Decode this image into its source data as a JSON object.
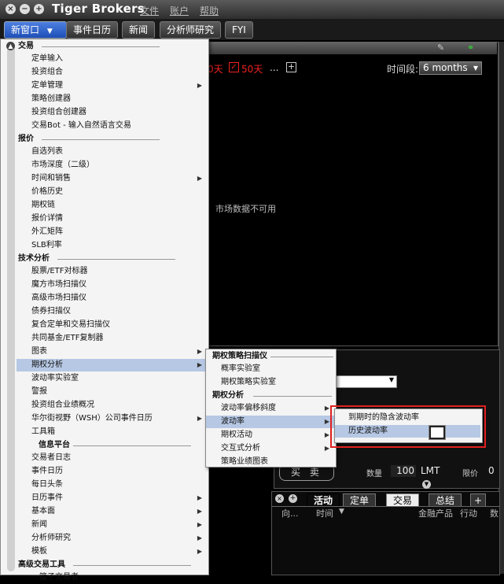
{
  "window": {
    "title": "Tiger Brokers",
    "menus": [
      "文件",
      "账户",
      "帮助"
    ]
  },
  "toolbar": {
    "new_window": "新窗口",
    "buttons": [
      "事件日历",
      "新闻",
      "分析师研究",
      "FYI"
    ]
  },
  "chart_panel": {
    "days_a": "0天",
    "days_b": "50天",
    "more": "...",
    "add": "+",
    "period_label": "时间段:",
    "period_value": "6 months",
    "no_data": "市场数据不可用"
  },
  "main_menu": {
    "sections": [
      {
        "title": "交易",
        "items": [
          "定单输入",
          "投资组合",
          "定单管理",
          "策略创建器",
          "投资组合创建器",
          "交易Bot - 输入自然语言交易"
        ]
      },
      {
        "title": "报价",
        "items": [
          "自选列表",
          "市场深度（二级）",
          "时间和销售",
          "价格历史",
          "期权链",
          "报价详情",
          "外汇矩阵",
          "SLB利率"
        ]
      },
      {
        "title": "技术分析",
        "items": [
          "股票/ETF对标器",
          "魔方市场扫描仪",
          "高级市场扫描仪",
          "债券扫描仪",
          "复合定单和交易扫描仪",
          "共同基金/ETF复制器",
          "图表",
          "期权分析",
          "波动率实验室",
          "警报",
          "投资组合业绩概况",
          "华尔街视野（WSH）公司事件日历",
          "工具箱"
        ]
      },
      {
        "title": "信息平台",
        "items": [
          "交易者日志",
          "事件日历",
          "每日头条",
          "日历事件",
          "基本面",
          "新闻",
          "分析师研究",
          "模板"
        ]
      },
      {
        "title": "高级交易工具",
        "items": [
          "一篮子交易者"
        ]
      }
    ]
  },
  "options_menu": {
    "sections": [
      {
        "title": "期权策略扫描仪",
        "items": [
          "概率实验室",
          "期权策略实验室"
        ]
      },
      {
        "title": "期权分析",
        "items": [
          "波动率偏移斜度",
          "波动率",
          "期权活动",
          "交互式分析",
          "策略业绩图表"
        ]
      }
    ]
  },
  "volatility_menu": {
    "items": [
      "到期时的隐含波动率",
      "历史波动率"
    ]
  },
  "order_panel": {
    "buy": "买",
    "sell": "卖",
    "qty_label": "数量",
    "qty_value": "100",
    "type_value": "LMT",
    "limit_label": "限价",
    "limit_value": "0"
  },
  "activity_panel": {
    "tabs": [
      "活动",
      "定单",
      "交易",
      "总结"
    ],
    "add": "+",
    "columns": [
      "向...",
      "时间",
      "金融产品",
      "行动",
      "数"
    ]
  },
  "colors": {
    "highlight": "#b6c8e4",
    "red_box": "#e02020",
    "new_window_btn": "#2f62cf"
  }
}
